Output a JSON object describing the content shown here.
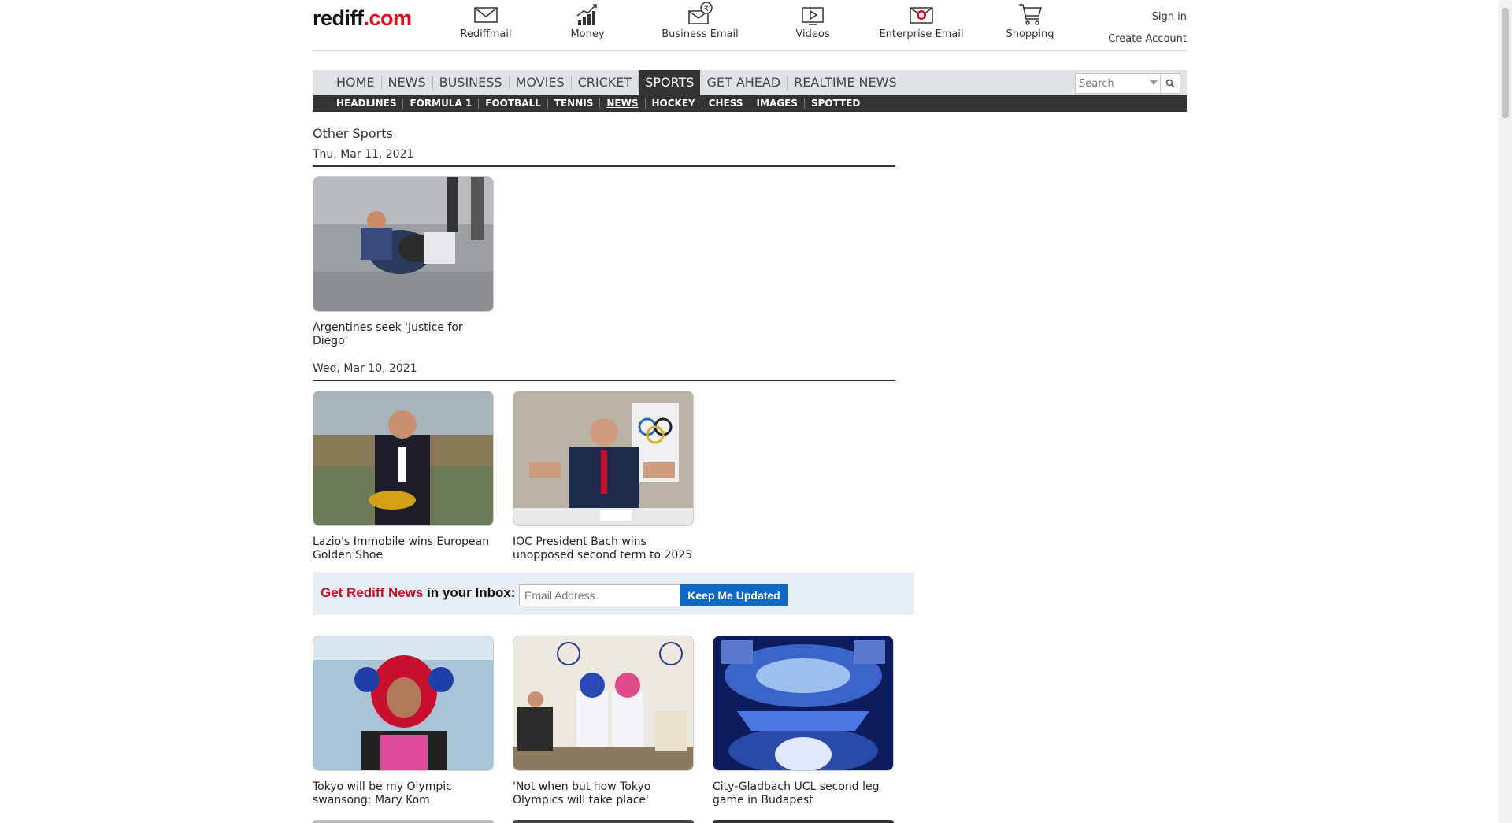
{
  "header": {
    "logo": {
      "a": "rediff",
      "dot": ".",
      "com": "com"
    },
    "services": [
      {
        "label": "Rediffmail",
        "icon": "mail-icon"
      },
      {
        "label": "Money",
        "icon": "chart-icon"
      },
      {
        "label": "Business Email",
        "icon": "business-mail-icon"
      },
      {
        "label": "Videos",
        "icon": "video-icon"
      },
      {
        "label": "Enterprise Email",
        "icon": "enterprise-mail-icon"
      },
      {
        "label": "Shopping",
        "icon": "cart-icon"
      }
    ],
    "sign_in": "Sign in",
    "create_account": "Create Account"
  },
  "nav": {
    "primary": [
      "HOME",
      "NEWS",
      "BUSINESS",
      "MOVIES",
      "CRICKET",
      "SPORTS",
      "GET AHEAD",
      "REALTIME NEWS"
    ],
    "active_primary": "SPORTS",
    "secondary": [
      "HEADLINES",
      "FORMULA 1",
      "FOOTBALL",
      "TENNIS",
      "NEWS",
      "HOCKEY",
      "CHESS",
      "IMAGES",
      "SPOTTED"
    ],
    "active_secondary": "NEWS",
    "search_placeholder": "Search"
  },
  "content": {
    "section_title": "Other Sports",
    "groups": [
      {
        "date": "Thu, Mar 11, 2021",
        "items": [
          {
            "caption": "Argentines seek 'Justice for Diego'"
          }
        ]
      },
      {
        "date": "Wed, Mar 10, 2021",
        "items": [
          {
            "caption": "Lazio's Immobile wins European Golden Shoe"
          },
          {
            "caption": "IOC President Bach wins unopposed second term to 2025"
          },
          {
            "caption": "Tokyo will be my Olympic swansong: Mary Kom"
          },
          {
            "caption": "'Not when but how Tokyo Olympics will take place'"
          },
          {
            "caption": "City-Gladbach UCL second leg game in Budapest"
          }
        ]
      }
    ]
  },
  "subscribe": {
    "label_red": "Get Rediff News",
    "label_rest": " in your Inbox:",
    "placeholder": "Email Address",
    "button": "Keep Me Updated"
  },
  "colors": {
    "brand_red": "#e1091a",
    "nav_dark": "#333333",
    "nav_light": "#dfe3e6",
    "button_blue": "#0e69c2"
  }
}
